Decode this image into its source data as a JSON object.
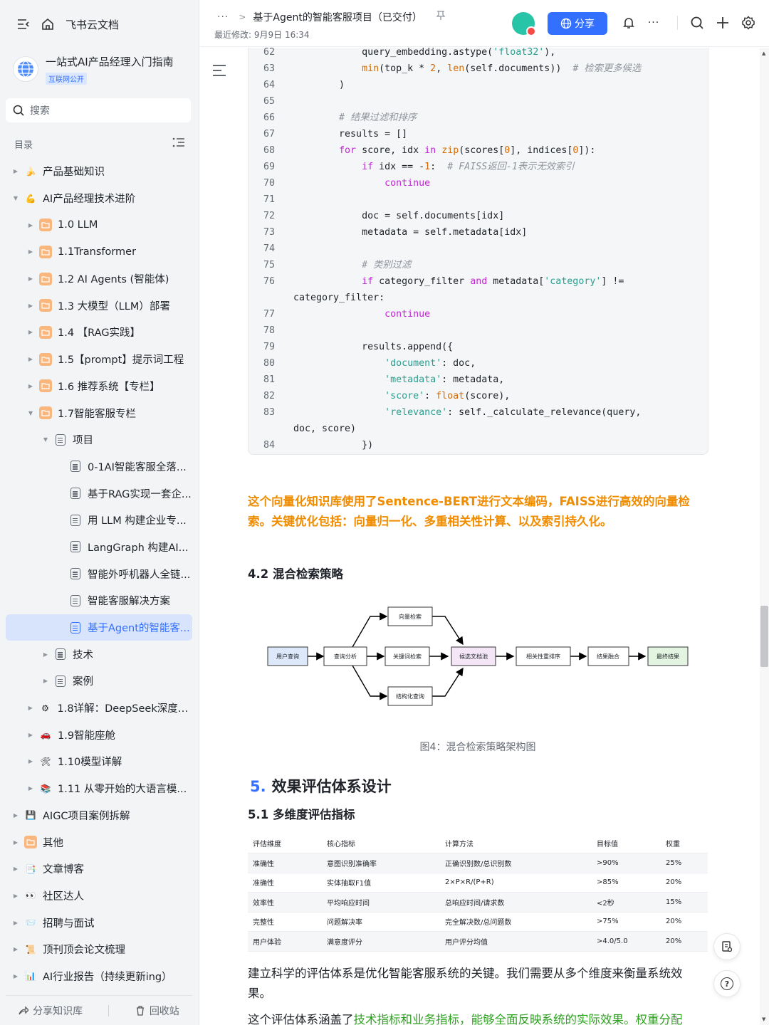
{
  "sidebar": {
    "brand": "飞书云文档",
    "kb_name": "一站式AI产品经理入门指南",
    "kb_badge": "互联网公开",
    "search_placeholder": "搜索",
    "toc_label": "目录",
    "footer_share": "分享知识库",
    "footer_recycle": "回收站",
    "items": [
      {
        "label": "产品基础知识",
        "level": 0,
        "arrow": "▶",
        "icon": "🍌"
      },
      {
        "label": "AI产品经理技术进阶",
        "level": 0,
        "arrow": "▼",
        "icon": "💪"
      },
      {
        "label": "1.0 LLM",
        "level": 1,
        "arrow": "▶",
        "icon": "folder"
      },
      {
        "label": "1.1Transformer",
        "level": 1,
        "arrow": "▶",
        "icon": "folder"
      },
      {
        "label": "1.2 AI Agents (智能体)",
        "level": 1,
        "arrow": "▶",
        "icon": "folder"
      },
      {
        "label": "1.3 大模型（LLM）部署",
        "level": 1,
        "arrow": "▶",
        "icon": "folder"
      },
      {
        "label": "1.4 【RAG实践】",
        "level": 1,
        "arrow": "▶",
        "icon": "folder"
      },
      {
        "label": "1.5【prompt】提示词工程",
        "level": 1,
        "arrow": "▶",
        "icon": "folder"
      },
      {
        "label": "1.6 推荐系统【专栏】",
        "level": 1,
        "arrow": "▶",
        "icon": "folder"
      },
      {
        "label": "1.7智能客服专栏",
        "level": 1,
        "arrow": "▼",
        "icon": "folder"
      },
      {
        "label": "项目",
        "level": 2,
        "arrow": "▼",
        "icon": "doc"
      },
      {
        "label": "0-1AI智能客服全落...",
        "level": 3,
        "arrow": "",
        "icon": "doc"
      },
      {
        "label": "基于RAG实现一套企...",
        "level": 3,
        "arrow": "",
        "icon": "doc"
      },
      {
        "label": "用 LLM 构建企业专...",
        "level": 3,
        "arrow": "",
        "icon": "doc"
      },
      {
        "label": "LangGraph 构建AI...",
        "level": 3,
        "arrow": "",
        "icon": "doc"
      },
      {
        "label": "智能外呼机器人全链...",
        "level": 3,
        "arrow": "",
        "icon": "doc"
      },
      {
        "label": "智能客服解决方案",
        "level": 3,
        "arrow": "",
        "icon": "doc"
      },
      {
        "label": "基于Agent的智能客...",
        "level": 3,
        "arrow": "",
        "icon": "doc",
        "active": true
      },
      {
        "label": "技术",
        "level": 2,
        "arrow": "▶",
        "icon": "doc"
      },
      {
        "label": "案例",
        "level": 2,
        "arrow": "▶",
        "icon": "doc"
      },
      {
        "label": "1.8详解：DeepSeek深度推...",
        "level": 1,
        "arrow": "▶",
        "icon": "⚙"
      },
      {
        "label": "1.9智能座舱",
        "level": 1,
        "arrow": "▶",
        "icon": "🚗"
      },
      {
        "label": "1.10模型详解",
        "level": 1,
        "arrow": "▶",
        "icon": "🛠"
      },
      {
        "label": "1.11 从零开始的大语言模...",
        "level": 1,
        "arrow": "▶",
        "icon": "📚"
      },
      {
        "label": "AIGC项目案例拆解",
        "level": 0,
        "arrow": "▶",
        "icon": "💾"
      },
      {
        "label": "其他",
        "level": 0,
        "arrow": "▶",
        "icon": "folder"
      },
      {
        "label": "文章博客",
        "level": 0,
        "arrow": "▶",
        "icon": "📑"
      },
      {
        "label": "社区达人",
        "level": 0,
        "arrow": "▶",
        "icon": "👀"
      },
      {
        "label": "招聘与面试",
        "level": 0,
        "arrow": "▶",
        "icon": "📨"
      },
      {
        "label": "顶刊顶会论文梳理",
        "level": 0,
        "arrow": "▶",
        "icon": "📜"
      },
      {
        "label": "AI行业报告（持续更新ing）",
        "level": 0,
        "arrow": "▶",
        "icon": "📊"
      }
    ]
  },
  "header": {
    "breadcrumb_dots": "···",
    "breadcrumb_sep": ">",
    "doc_title": "基于Agent的智能客服项目（已交付）",
    "last_modified": "最近修改: 9月9日 16:34",
    "share_label": "分享",
    "more": "···"
  },
  "code": [
    {
      "n": "62",
      "h": "            query_embedding.astype(<s>'float32'</s>),"
    },
    {
      "n": "63",
      "h": "            <f>min</f>(top_k * <n>2</n>, <f>len</f>(self.documents))  <c># 检索更多候选</c>"
    },
    {
      "n": "64",
      "h": "        )"
    },
    {
      "n": "65",
      "h": ""
    },
    {
      "n": "66",
      "h": "        <c># 结果过滤和排序</c>"
    },
    {
      "n": "67",
      "h": "        results = []"
    },
    {
      "n": "68",
      "h": "        <k>for</k> score, idx <k>in</k> <f>zip</f>(scores[<n>0</n>], indices[<n>0</n>]):"
    },
    {
      "n": "69",
      "h": "            <k>if</k> idx == -<n>1</n>:  <c># FAISS返回-1表示无效索引</c>"
    },
    {
      "n": "70",
      "h": "                <k>continue</k>"
    },
    {
      "n": "71",
      "h": ""
    },
    {
      "n": "72",
      "h": "            doc = self.documents[idx]"
    },
    {
      "n": "73",
      "h": "            metadata = self.metadata[idx]"
    },
    {
      "n": "74",
      "h": ""
    },
    {
      "n": "75",
      "h": "            <c># 类别过滤</c>"
    },
    {
      "n": "76",
      "h": "            <k>if</k> category_filter <k>and</k> metadata[<s>'category'</s>] !="
    },
    {
      "n": "",
      "h": "category_filter:"
    },
    {
      "n": "77",
      "h": "                <k>continue</k>"
    },
    {
      "n": "78",
      "h": ""
    },
    {
      "n": "79",
      "h": "            results.append({"
    },
    {
      "n": "80",
      "h": "                <s>'document'</s>: doc,"
    },
    {
      "n": "81",
      "h": "                <s>'metadata'</s>: metadata,"
    },
    {
      "n": "82",
      "h": "                <s>'score'</s>: <f>float</f>(score),"
    },
    {
      "n": "83",
      "h": "                <s>'relevance'</s>: self._calculate_relevance(query,"
    },
    {
      "n": "",
      "h": "doc, score)"
    },
    {
      "n": "84",
      "h": "            })"
    }
  ],
  "content": {
    "highlight": "这个向量化知识库使用了Sentence-BERT进行文本编码，FAISS进行高效的向量检索。关键优化包括：向量归一化、多重相关性计算、以及索引持久化。",
    "h42": "4.2 混合检索策略",
    "diagram": {
      "user_query": "用户查询",
      "query_analysis": "查询分析",
      "vector_search": "向量检索",
      "keyword_search": "关键词检索",
      "structured_query": "结构化查询",
      "candidates": "候选文档池",
      "rerank": "相关性重排序",
      "fusion": "结果融合",
      "final": "最终结果"
    },
    "caption": "图4：混合检索策略架构图",
    "h5_num": "5.",
    "h5_title": "效果评估体系设计",
    "h51": "5.1 多维度评估指标",
    "table": [
      [
        "评估维度",
        "核心指标",
        "计算方法",
        "目标值",
        "权重"
      ],
      [
        "准确性",
        "意图识别准确率",
        "正确识别数/总识别数",
        ">90%",
        "25%"
      ],
      [
        "准确性",
        "实体抽取F1值",
        "2×P×R/(P+R)",
        ">85%",
        "20%"
      ],
      [
        "效率性",
        "平均响应时间",
        "总响应时间/请求数",
        "<2秒",
        "15%"
      ],
      [
        "完整性",
        "问题解决率",
        "完全解决数/总问题数",
        ">75%",
        "20%"
      ],
      [
        "用户体验",
        "满意度评分",
        "用户评分均值",
        ">4.0/5.0",
        "20%"
      ]
    ],
    "p1": "建立科学的评估体系是优化智能客服系统的关键。我们需要从多个维度来衡量系统效果。",
    "p2_a": "这个评估体系涵盖了",
    "p2_b": "技术指标和业务指标，能够全面反映系统的实际效果。权重分配"
  },
  "colors": {
    "accent": "#3370ff",
    "highlight": "#f08c00",
    "green": "#2ea121"
  }
}
